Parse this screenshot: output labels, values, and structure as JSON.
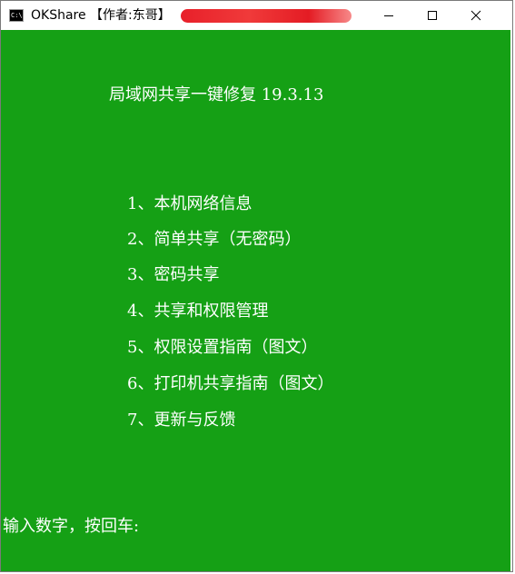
{
  "window": {
    "title": "OKShare  【作者:东哥】",
    "icon": "console-app-icon",
    "icon_text": "C:\\."
  },
  "controls": {
    "minimize": "minimize-icon",
    "maximize": "maximize-icon",
    "close": "close-icon"
  },
  "console": {
    "heading": "局域网共享一键修复 19.3.13",
    "separator": "______________________________________________________",
    "menu": [
      {
        "label": "1、本机网络信息"
      },
      {
        "label": "2、简单共享（无密码）"
      },
      {
        "label": "3、密码共享"
      },
      {
        "label": "4、共享和权限管理"
      },
      {
        "label": "5、权限设置指南（图文）"
      },
      {
        "label": "6、打印机共享指南（图文）"
      },
      {
        "label": "7、更新与反馈"
      }
    ],
    "prompt": "输入数字，按回车:"
  },
  "colors": {
    "console_background": "#15a015",
    "console_text": "#ffffff",
    "redaction": "#e8202a"
  }
}
